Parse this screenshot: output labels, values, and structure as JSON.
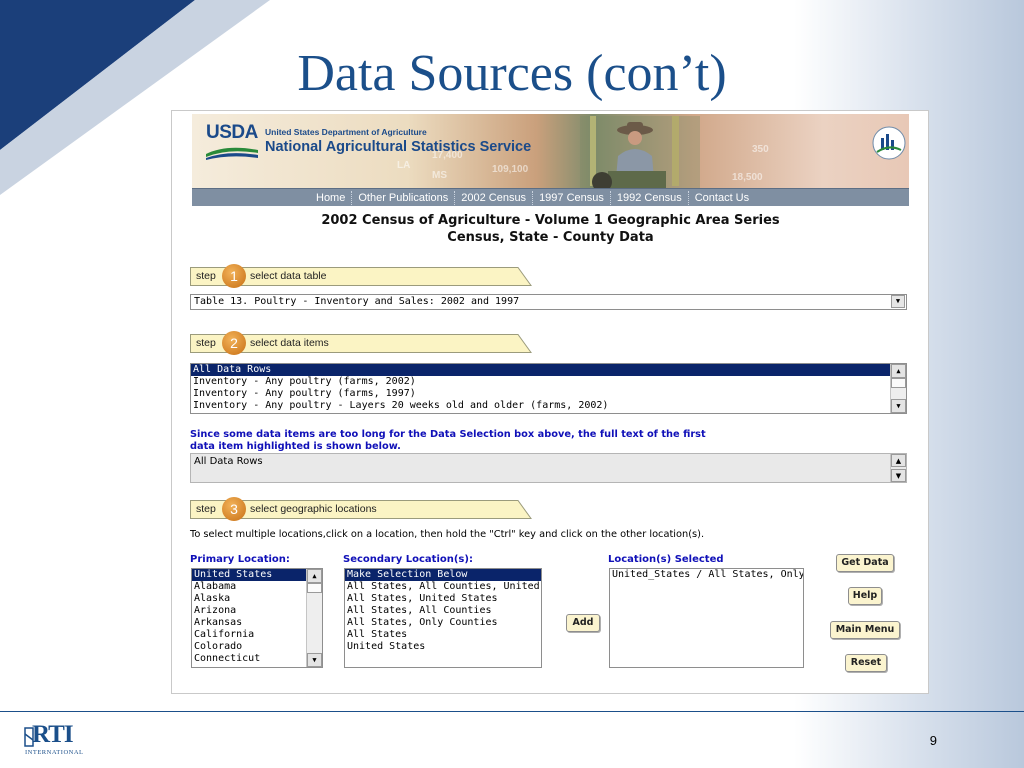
{
  "slide": {
    "title": "Data Sources (con’t)",
    "page_number": "9",
    "logo": {
      "name": "RTI",
      "sub": "INTERNATIONAL"
    }
  },
  "banner": {
    "logo_text": "USDA",
    "department": "United States Department of Agriculture",
    "agency": "National Agricultural Statistics Service"
  },
  "nav": {
    "items": [
      "Home",
      "Other Publications",
      "2002 Census",
      "1997 Census",
      "1992 Census",
      "Contact Us"
    ]
  },
  "page": {
    "title_line1": "2002 Census of Agriculture - Volume 1 Geographic Area Series",
    "title_line2": "Census, State - County Data"
  },
  "steps": [
    {
      "word": "step",
      "number": "1",
      "label": "select data table"
    },
    {
      "word": "step",
      "number": "2",
      "label": "select data items"
    },
    {
      "word": "step",
      "number": "3",
      "label": "select geographic locations"
    }
  ],
  "data_table": {
    "selected": "Table 13. Poultry - Inventory and Sales: 2002 and 1997"
  },
  "data_items": {
    "options": [
      "All Data Rows",
      "Inventory - Any poultry (farms, 2002)",
      "Inventory - Any poultry (farms, 1997)",
      "Inventory - Any poultry - Layers 20 weeks old and older (farms, 2002)"
    ]
  },
  "note": {
    "line1": "Since some data items are too long for the Data Selection box above, the full text of the first",
    "line2": "data item highlighted is shown below.",
    "fulltext": "All Data Rows"
  },
  "instructions": "To select multiple locations,click on a location, then hold the \"Ctrl\" key and click on the other location(s).",
  "primary": {
    "label": "Primary Location:",
    "options": [
      "United States",
      "Alabama",
      "Alaska",
      "Arizona",
      "Arkansas",
      "California",
      "Colorado",
      "Connecticut"
    ]
  },
  "secondary": {
    "label": "Secondary Location(s):",
    "options": [
      "Make Selection Below",
      "All States, All Counties, United State",
      "All States, United States",
      "All States, All Counties",
      "All States, Only Counties",
      "All States",
      "United States"
    ]
  },
  "selected_locations": {
    "label": "Location(s) Selected",
    "options": [
      "United_States / All States, Only Cou"
    ]
  },
  "buttons": {
    "add": "Add",
    "get_data": "Get Data",
    "help": "Help",
    "main_menu": "Main Menu",
    "reset": "Reset"
  },
  "colors": {
    "slide_title": "#1b4f8a",
    "link_blue": "#1010b8",
    "selection": "#0a246a",
    "step_badge": "#e08a2a",
    "button_bg": "#fbf4cf"
  }
}
